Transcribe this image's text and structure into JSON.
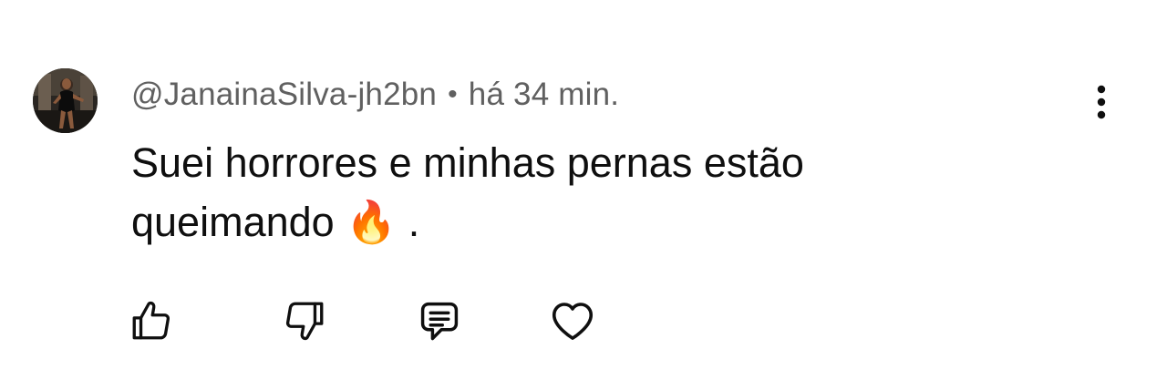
{
  "comment": {
    "author": "@JanainaSilva-jh2bn",
    "separator": "•",
    "time": "há 34 min.",
    "text": "Suei horrores e minhas pernas estão queimando 🔥 .",
    "text_parts": {
      "main": "Suei horrores e minhas pernas estão queimando ",
      "emoji": "🔥",
      "tail": " ."
    }
  },
  "icons": {
    "avatar": "avatar",
    "more": "more-vertical-icon",
    "like": "thumbs-up-icon",
    "dislike": "thumbs-down-icon",
    "reply": "reply-comment-icon",
    "heart": "heart-icon"
  },
  "colors": {
    "text": "#0f0f0f",
    "meta": "#606060",
    "background": "#ffffff"
  }
}
